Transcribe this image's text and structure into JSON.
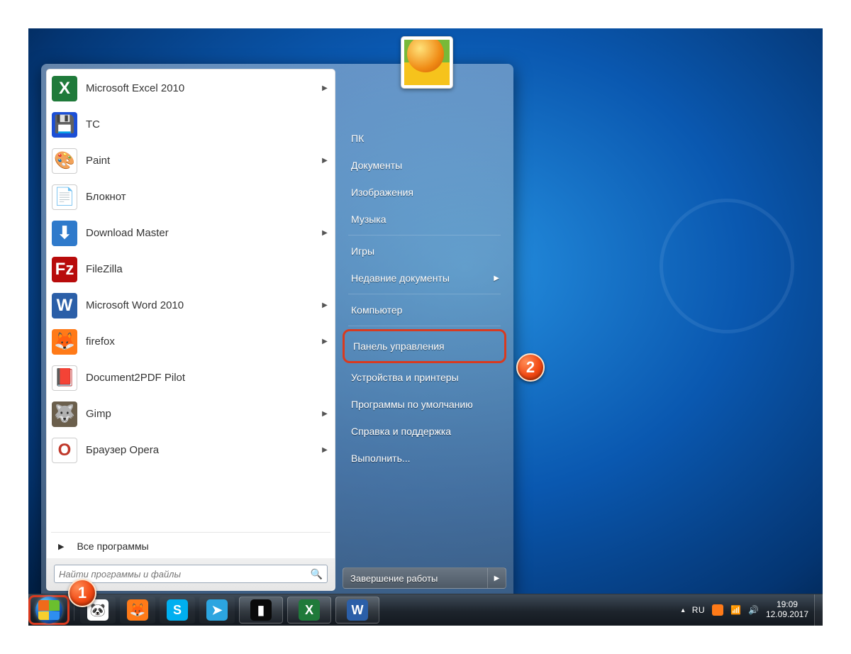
{
  "start_menu": {
    "programs": [
      {
        "label": "Microsoft Excel 2010",
        "icon_bg": "#1f7a3a",
        "icon_text": "X",
        "submenu": true
      },
      {
        "label": "TC",
        "icon_bg": "#1c4fd6",
        "icon_text": "💾",
        "submenu": false
      },
      {
        "label": "Paint",
        "icon_bg": "#ffffff",
        "icon_text": "🎨",
        "submenu": true
      },
      {
        "label": "Блокнот",
        "icon_bg": "#ffffff",
        "icon_text": "📄",
        "submenu": false
      },
      {
        "label": "Download Master",
        "icon_bg": "#2f7acb",
        "icon_text": "⬇",
        "submenu": true
      },
      {
        "label": "FileZilla",
        "icon_bg": "#b80b0b",
        "icon_text": "Fz",
        "submenu": false
      },
      {
        "label": "Microsoft Word 2010",
        "icon_bg": "#2b5fa8",
        "icon_text": "W",
        "submenu": true
      },
      {
        "label": "firefox",
        "icon_bg": "#ff7a18",
        "icon_text": "🦊",
        "submenu": true
      },
      {
        "label": "Document2PDF Pilot",
        "icon_bg": "#ffffff",
        "icon_text": "📕",
        "submenu": false
      },
      {
        "label": "Gimp",
        "icon_bg": "#6b5f4c",
        "icon_text": "🐺",
        "submenu": true
      },
      {
        "label": "Браузер Opera",
        "icon_bg": "#ffffff",
        "icon_text": "O",
        "submenu": true
      }
    ],
    "all_programs": "Все программы",
    "search_placeholder": "Найти программы и файлы",
    "system_items": [
      {
        "label": "ПК",
        "type": "item"
      },
      {
        "label": "Документы",
        "type": "item"
      },
      {
        "label": "Изображения",
        "type": "item"
      },
      {
        "label": "Музыка",
        "type": "item"
      },
      {
        "type": "sep"
      },
      {
        "label": "Игры",
        "type": "item"
      },
      {
        "label": "Недавние документы",
        "type": "item",
        "submenu": true
      },
      {
        "type": "sep"
      },
      {
        "label": "Компьютер",
        "type": "item"
      },
      {
        "type": "sep"
      },
      {
        "label": "Панель управления",
        "type": "highlight"
      },
      {
        "label": "Устройства и принтеры",
        "type": "item"
      },
      {
        "label": "Программы по умолчанию",
        "type": "item"
      },
      {
        "label": "Справка и поддержка",
        "type": "item"
      },
      {
        "label": "Выполнить...",
        "type": "item"
      }
    ],
    "shutdown_label": "Завершение работы"
  },
  "taskbar": {
    "pinned": [
      {
        "name": "panda",
        "bg": "#ffffff",
        "glyph": "🐼",
        "active": false
      },
      {
        "name": "firefox",
        "bg": "#ff7a18",
        "glyph": "🦊",
        "active": false
      },
      {
        "name": "skype",
        "bg": "#00aff0",
        "glyph": "S",
        "active": false
      },
      {
        "name": "telegram",
        "bg": "#2ca5e0",
        "glyph": "➤",
        "active": false
      },
      {
        "name": "terminal",
        "bg": "#0a0a0a",
        "glyph": "▮",
        "active": true
      },
      {
        "name": "excel",
        "bg": "#1f7a3a",
        "glyph": "X",
        "active": true
      },
      {
        "name": "word",
        "bg": "#2b5fa8",
        "glyph": "W",
        "active": true
      }
    ],
    "language": "RU",
    "time": "19:09",
    "date": "12.09.2017"
  },
  "callouts": {
    "start_button": "1",
    "control_panel": "2"
  }
}
